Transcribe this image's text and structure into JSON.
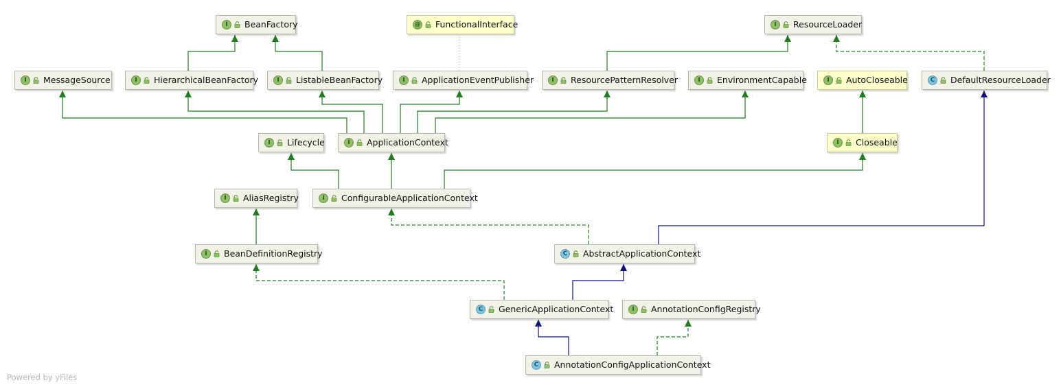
{
  "nodes": {
    "bean_factory": {
      "label": "BeanFactory",
      "kind": "I"
    },
    "functional_interface": {
      "label": "FunctionalInterface",
      "kind": "@"
    },
    "resource_loader": {
      "label": "ResourceLoader",
      "kind": "I"
    },
    "message_source": {
      "label": "MessageSource",
      "kind": "I"
    },
    "hierarchical_bean_factory": {
      "label": "HierarchicalBeanFactory",
      "kind": "I"
    },
    "listable_bean_factory": {
      "label": "ListableBeanFactory",
      "kind": "I"
    },
    "application_event_publisher": {
      "label": "ApplicationEventPublisher",
      "kind": "I"
    },
    "resource_pattern_resolver": {
      "label": "ResourcePatternResolver",
      "kind": "I"
    },
    "environment_capable": {
      "label": "EnvironmentCapable",
      "kind": "I"
    },
    "auto_closeable": {
      "label": "AutoCloseable",
      "kind": "I"
    },
    "default_resource_loader": {
      "label": "DefaultResourceLoader",
      "kind": "C"
    },
    "lifecycle": {
      "label": "Lifecycle",
      "kind": "I"
    },
    "application_context": {
      "label": "ApplicationContext",
      "kind": "I"
    },
    "closeable": {
      "label": "Closeable",
      "kind": "I"
    },
    "alias_registry": {
      "label": "AliasRegistry",
      "kind": "I"
    },
    "configurable_application_context": {
      "label": "ConfigurableApplicationContext",
      "kind": "I"
    },
    "bean_definition_registry": {
      "label": "BeanDefinitionRegistry",
      "kind": "I"
    },
    "abstract_application_context": {
      "label": "AbstractApplicationContext",
      "kind": "C"
    },
    "generic_application_context": {
      "label": "GenericApplicationContext",
      "kind": "C"
    },
    "annotation_config_registry": {
      "label": "AnnotationConfigRegistry",
      "kind": "I"
    },
    "annotation_config_application_context": {
      "label": "AnnotationConfigApplicationContext",
      "kind": "C"
    }
  },
  "edges": [
    {
      "from": "hierarchical_bean_factory",
      "to": "bean_factory",
      "type": "extends"
    },
    {
      "from": "listable_bean_factory",
      "to": "bean_factory",
      "type": "extends"
    },
    {
      "from": "application_event_publisher",
      "to": "functional_interface",
      "type": "annotated"
    },
    {
      "from": "resource_pattern_resolver",
      "to": "resource_loader",
      "type": "extends"
    },
    {
      "from": "default_resource_loader",
      "to": "resource_loader",
      "type": "implements"
    },
    {
      "from": "application_context",
      "to": "message_source",
      "type": "extends"
    },
    {
      "from": "application_context",
      "to": "hierarchical_bean_factory",
      "type": "extends"
    },
    {
      "from": "application_context",
      "to": "listable_bean_factory",
      "type": "extends"
    },
    {
      "from": "application_context",
      "to": "application_event_publisher",
      "type": "extends"
    },
    {
      "from": "application_context",
      "to": "resource_pattern_resolver",
      "type": "extends"
    },
    {
      "from": "application_context",
      "to": "environment_capable",
      "type": "extends"
    },
    {
      "from": "closeable",
      "to": "auto_closeable",
      "type": "extends"
    },
    {
      "from": "configurable_application_context",
      "to": "lifecycle",
      "type": "extends"
    },
    {
      "from": "configurable_application_context",
      "to": "application_context",
      "type": "extends"
    },
    {
      "from": "configurable_application_context",
      "to": "closeable",
      "type": "extends"
    },
    {
      "from": "bean_definition_registry",
      "to": "alias_registry",
      "type": "extends"
    },
    {
      "from": "abstract_application_context",
      "to": "configurable_application_context",
      "type": "implements"
    },
    {
      "from": "abstract_application_context",
      "to": "default_resource_loader",
      "type": "class-extends"
    },
    {
      "from": "generic_application_context",
      "to": "bean_definition_registry",
      "type": "implements"
    },
    {
      "from": "generic_application_context",
      "to": "abstract_application_context",
      "type": "class-extends"
    },
    {
      "from": "annotation_config_application_context",
      "to": "generic_application_context",
      "type": "class-extends"
    },
    {
      "from": "annotation_config_application_context",
      "to": "annotation_config_registry",
      "type": "implements"
    }
  ],
  "colors": {
    "interface_edge": "#1e7d1e",
    "class_edge": "#101080",
    "annotation_edge": "#8fbf68",
    "node_fill": "#f2f2e9",
    "annotation_fill": "#ffffcc"
  },
  "watermark": "Powered by yFiles"
}
